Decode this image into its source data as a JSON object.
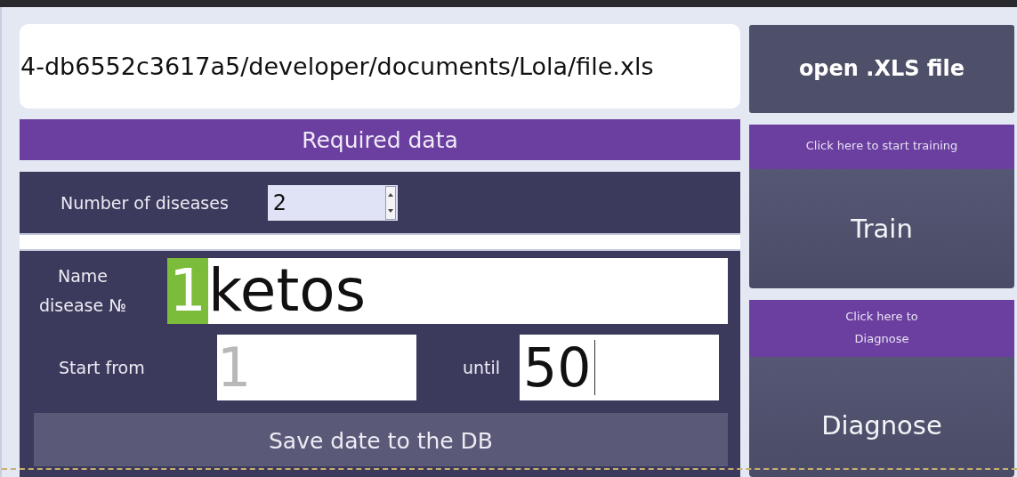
{
  "file_path": {
    "value": "4-db6552c3617a5/developer/documents/Lola/file.xls"
  },
  "open_button": {
    "label": "open .XLS file"
  },
  "required_header": {
    "title": "Required data"
  },
  "number_of_diseases": {
    "label": "Number of diseases",
    "value": "2"
  },
  "disease": {
    "label": "Name disease №",
    "number": "1",
    "value": "ketos"
  },
  "range": {
    "start_label": "Start from",
    "start_placeholder": "1",
    "until_label": "until",
    "until_value": "50"
  },
  "save_button": {
    "label": "Save date to the DB"
  },
  "train": {
    "hint": "Click here to start training",
    "label": "Train"
  },
  "diagnose": {
    "hint": "Click here to Diagnose",
    "label": "Diagnose"
  }
}
